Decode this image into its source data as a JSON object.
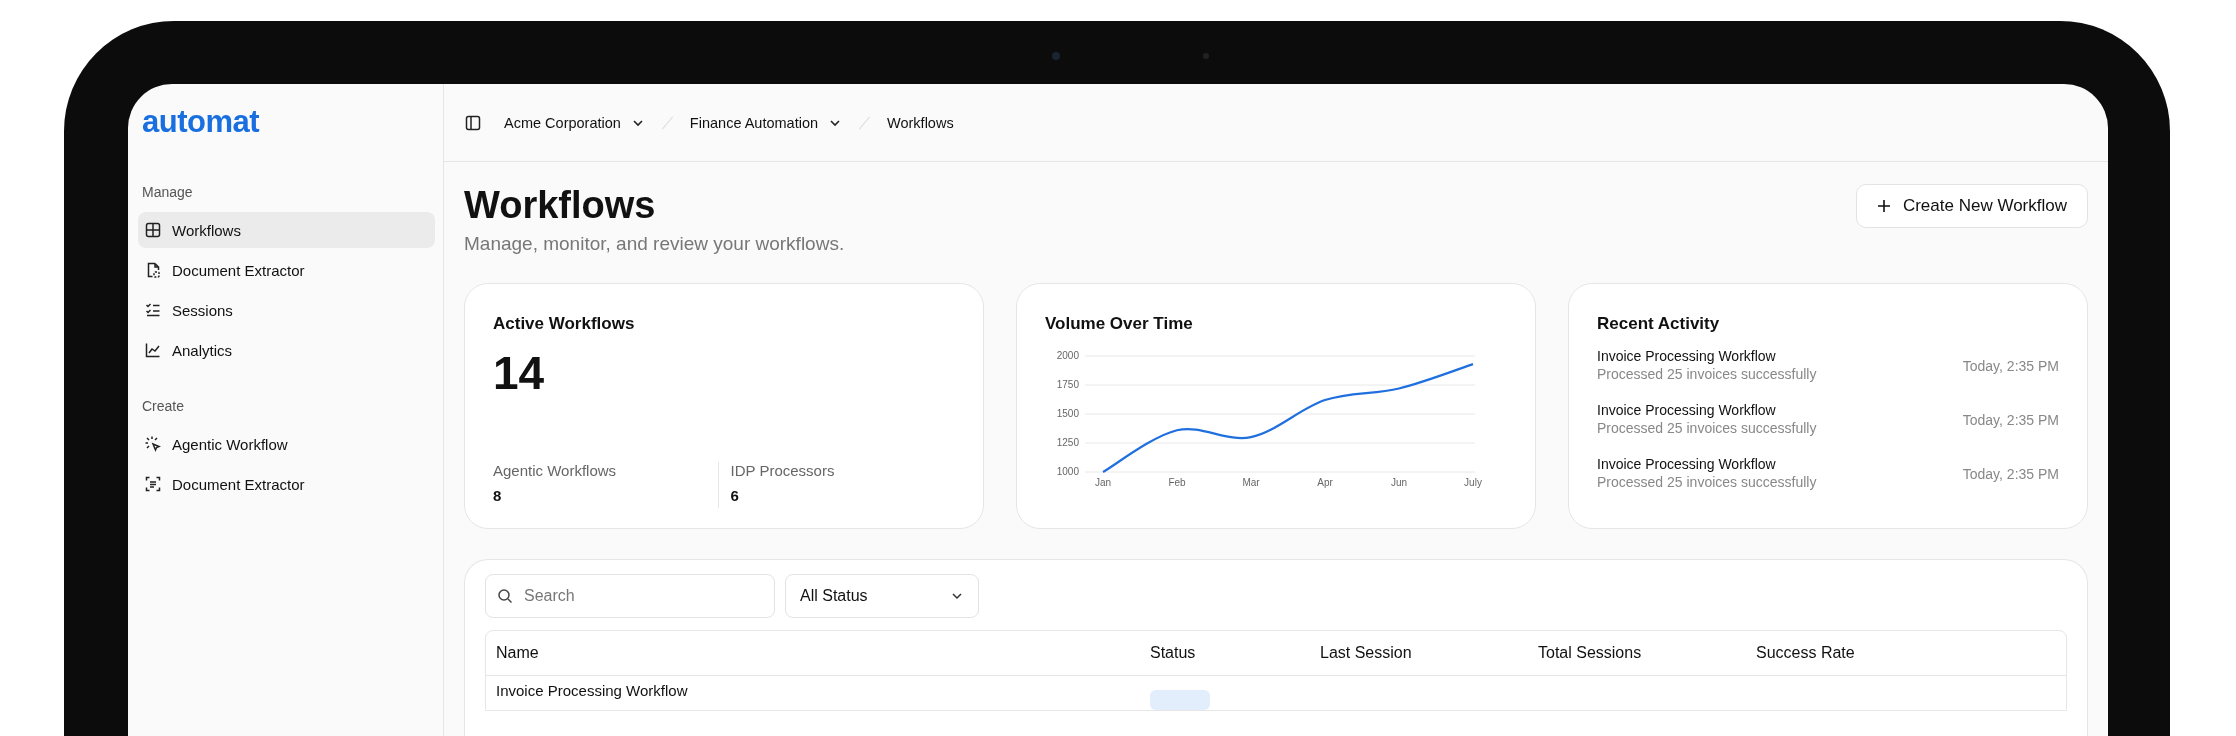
{
  "sidebar": {
    "logo": "automat",
    "sections": [
      {
        "title": "Manage",
        "items": [
          {
            "label": "Workflows",
            "selected": true
          },
          {
            "label": "Document Extractor",
            "selected": false
          },
          {
            "label": "Sessions",
            "selected": false
          },
          {
            "label": "Analytics",
            "selected": false
          }
        ]
      },
      {
        "title": "Create",
        "items": [
          {
            "label": "Agentic Workflow",
            "selected": false
          },
          {
            "label": "Document Extractor",
            "selected": false
          }
        ]
      }
    ]
  },
  "breadcrumbs": [
    {
      "label": "Acme Corporation",
      "dropdown": true
    },
    {
      "label": "Finance Automation",
      "dropdown": true
    },
    {
      "label": "Workflows",
      "dropdown": false
    }
  ],
  "header": {
    "title": "Workflows",
    "subtitle": "Manage, monitor, and review your workflows.",
    "action": "Create New Workflow"
  },
  "stats": {
    "title": "Active Workflows",
    "value": "14",
    "items": [
      {
        "label": "Agentic Workflows",
        "value": "8"
      },
      {
        "label": "IDP Processors",
        "value": "6"
      }
    ]
  },
  "volume": {
    "title": "Volume Over Time",
    "chart_data": {
      "type": "line",
      "categories": [
        "Jan",
        "Feb",
        "Mar",
        "Apr",
        "Jun",
        "July"
      ],
      "grid": true,
      "series": [
        {
          "color": "#1f6fde",
          "values": [
            1000,
            1360,
            1300,
            1620,
            1720,
            1930
          ]
        }
      ],
      "ylim": [
        1000,
        2000
      ],
      "yticks": [
        1000,
        1250,
        1500,
        1750,
        2000
      ]
    }
  },
  "activity": {
    "title": "Recent Activity",
    "items": [
      {
        "title": "Invoice Processing Workflow",
        "detail": "Processed 25 invoices successfully",
        "time": "Today, 2:35 PM"
      },
      {
        "title": "Invoice Processing Workflow",
        "detail": "Processed 25 invoices successfully",
        "time": "Today, 2:35 PM"
      },
      {
        "title": "Invoice Processing Workflow",
        "detail": "Processed 25 invoices successfully",
        "time": "Today, 2:35 PM"
      }
    ]
  },
  "table": {
    "search": {
      "placeholder": "Search"
    },
    "filter": "All Status",
    "columns": [
      "Name",
      "Status",
      "Last Session",
      "Total Sessions",
      "Success Rate"
    ],
    "rows": [
      {
        "name": "Invoice Processing Workflow"
      }
    ]
  }
}
